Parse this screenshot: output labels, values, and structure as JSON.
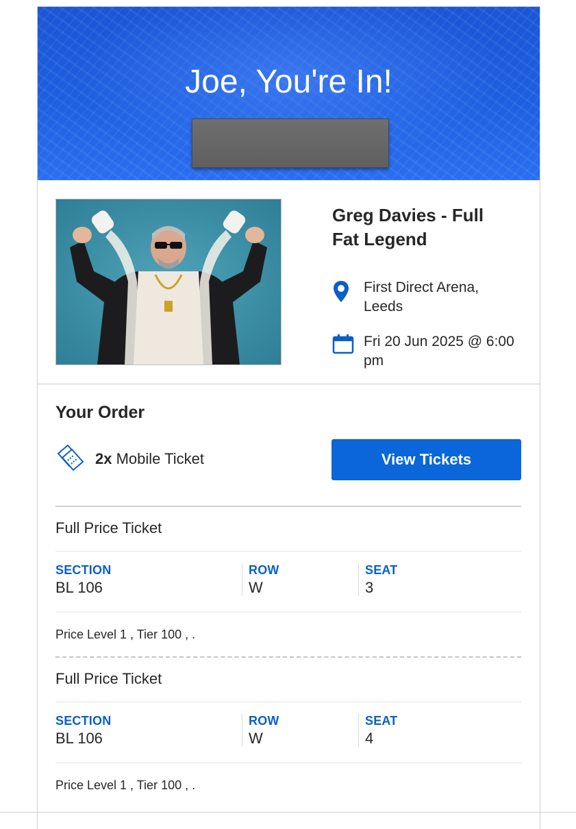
{
  "hero": {
    "title": "Joe, You're In!",
    "background_color": "#1d5fe0",
    "redacted_block_color": "#666666"
  },
  "event": {
    "title": "Greg Davies - Full Fat Legend",
    "venue": "First Direct Arena, Leeds",
    "date": "Fri 20 Jun 2025 @ 6:00 pm",
    "location_icon": "map-pin-icon",
    "calendar_icon": "calendar-icon",
    "icon_color": "#0a5fc7"
  },
  "order": {
    "title": "Your Order",
    "quantity": "2x",
    "ticket_kind": "Mobile Ticket",
    "ticket_icon": "tickets-icon",
    "view_button_label": "View Tickets",
    "button_color": "#0a66d9",
    "tickets": [
      {
        "type": "Full Price Ticket",
        "section_label": "SECTION",
        "section": "BL 106",
        "row_label": "ROW",
        "row": "W",
        "seat_label": "SEAT",
        "seat": "3",
        "price_level": "Price Level 1 , Tier 100 , ."
      },
      {
        "type": "Full Price Ticket",
        "section_label": "SECTION",
        "section": "BL 106",
        "row_label": "ROW",
        "row": "W",
        "seat_label": "SEAT",
        "seat": "4",
        "price_level": "Price Level 1 , Tier 100 , ."
      }
    ]
  }
}
